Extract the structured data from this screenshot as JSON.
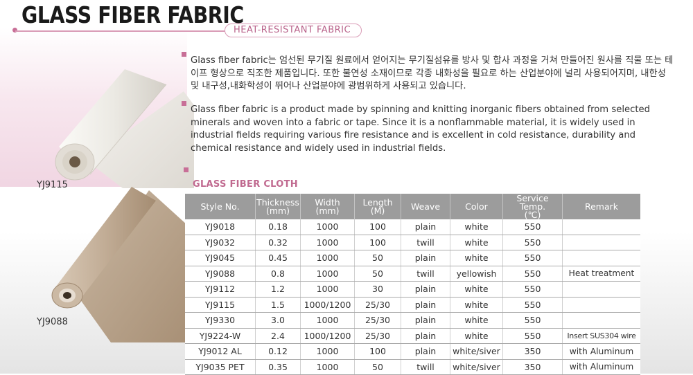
{
  "header": {
    "title": "GLASS FIBER FABRIC",
    "subtitle": "HEAT-RESISTANT FABRIC"
  },
  "description": {
    "korean": "Glass fiber fabric는 엄선된 무기질 원료에서 얻어지는 무기질섬유를 방사 및 합사 과정을 거쳐 만들어진 원사를 직물 또는 테이프 형상으로 직조한 제품입니다. 또한 불연성 소재이므로 각종 내화성을 필요로 하는 산업분야에 널리 사용되어지며, 내한성 및 내구성,내화학성이 뛰어나 산업분야에 광범위하게 사용되고 있습니다.",
    "english": "Glass fiber fabric is a product made by spinning and knitting inorganic fibers obtained from selected minerals and woven into a fabric or tape. Since it is a nonflammable material, it is widely used in industrial fields requiring various fire resistance and is excellent in cold resistance, durability and chemical resistance and widely used in industrial fields."
  },
  "images": {
    "top_caption": "YJ9115",
    "bottom_caption": "YJ9088"
  },
  "table": {
    "section_title": "GLASS FIBER CLOTH",
    "headers": {
      "style": "Style No.",
      "thickness": "Thickness",
      "thickness_unit": "(mm)",
      "width": "Width",
      "width_unit": "(mm)",
      "length": "Length",
      "length_unit": "(M)",
      "weave": "Weave",
      "color": "Color",
      "service": "Service Temp.",
      "service_unit": "(℃)",
      "remark": "Remark"
    },
    "rows": [
      [
        "YJ9018",
        "0.18",
        "1000",
        "100",
        "plain",
        "white",
        "550",
        ""
      ],
      [
        "YJ9032",
        "0.32",
        "1000",
        "100",
        "twill",
        "white",
        "550",
        ""
      ],
      [
        "YJ9045",
        "0.45",
        "1000",
        "50",
        "plain",
        "white",
        "550",
        ""
      ],
      [
        "YJ9088",
        "0.8",
        "1000",
        "50",
        "twill",
        "yellowish",
        "550",
        "Heat treatment"
      ],
      [
        "YJ9112",
        "1.2",
        "1000",
        "30",
        "plain",
        "white",
        "550",
        ""
      ],
      [
        "YJ9115",
        "1.5",
        "1000/1200",
        "25/30",
        "plain",
        "white",
        "550",
        ""
      ],
      [
        "YJ9330",
        "3.0",
        "1000",
        "25/30",
        "plain",
        "white",
        "550",
        ""
      ],
      [
        "YJ9224-W",
        "2.4",
        "1000/1200",
        "25/30",
        "plain",
        "white",
        "550",
        "Insert SUS304 wire"
      ],
      [
        "YJ9012 AL",
        "0.12",
        "1000",
        "100",
        "plain",
        "white/siver",
        "350",
        "with Aluminum"
      ],
      [
        "YJ9035 PET",
        "0.35",
        "1000",
        "50",
        "twill",
        "white/siver",
        "350",
        "with Aluminum"
      ]
    ]
  },
  "colors": {
    "accent_pink": "#c0698f",
    "header_gray": "#9c9c9c"
  }
}
